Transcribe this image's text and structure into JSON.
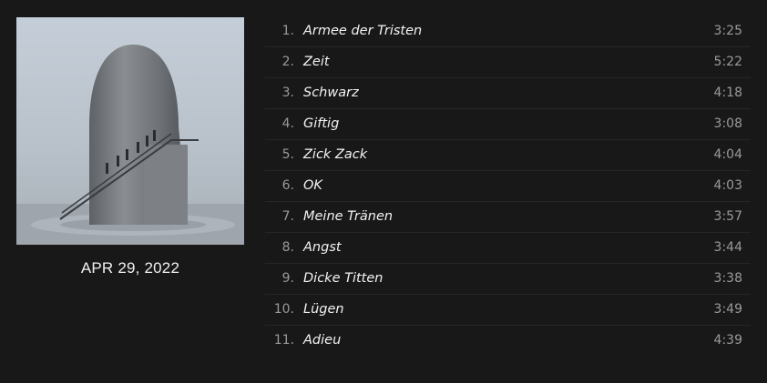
{
  "album": {
    "cover_alt": "album-cover",
    "release_date": "APR 29, 2022"
  },
  "tracks": [
    {
      "num": "1.",
      "title": "Armee der Tristen",
      "duration": "3:25"
    },
    {
      "num": "2.",
      "title": "Zeit",
      "duration": "5:22"
    },
    {
      "num": "3.",
      "title": "Schwarz",
      "duration": "4:18"
    },
    {
      "num": "4.",
      "title": "Giftig",
      "duration": "3:08"
    },
    {
      "num": "5.",
      "title": "Zick Zack",
      "duration": "4:04"
    },
    {
      "num": "6.",
      "title": "OK",
      "duration": "4:03"
    },
    {
      "num": "7.",
      "title": "Meine Tränen",
      "duration": "3:57"
    },
    {
      "num": "8.",
      "title": "Angst",
      "duration": "3:44"
    },
    {
      "num": "9.",
      "title": "Dicke Titten",
      "duration": "3:38"
    },
    {
      "num": "10.",
      "title": "Lügen",
      "duration": "3:49"
    },
    {
      "num": "11.",
      "title": "Adieu",
      "duration": "4:39"
    }
  ],
  "colors": {
    "background": "#181818",
    "divider": "#262626",
    "text_primary": "#f2f2f2",
    "text_secondary": "#9a9a9a"
  }
}
